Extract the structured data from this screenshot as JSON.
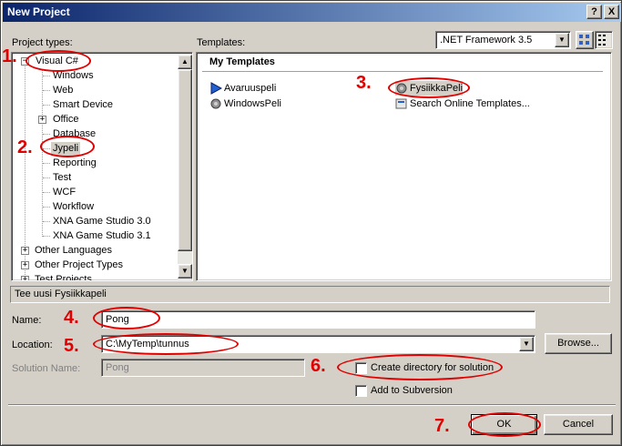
{
  "window": {
    "title": "New Project"
  },
  "titlebar_buttons": {
    "help": "?",
    "close": "X"
  },
  "project_types": {
    "label": "Project types:",
    "items": [
      {
        "label": "Visual C#",
        "expander": "−"
      },
      {
        "label": "Windows"
      },
      {
        "label": "Web"
      },
      {
        "label": "Smart Device"
      },
      {
        "label": "Office",
        "expander": "+"
      },
      {
        "label": "Database"
      },
      {
        "label": "Jypeli"
      },
      {
        "label": "Reporting"
      },
      {
        "label": "Test"
      },
      {
        "label": "WCF"
      },
      {
        "label": "Workflow"
      },
      {
        "label": "XNA Game Studio 3.0"
      },
      {
        "label": "XNA Game Studio 3.1"
      },
      {
        "label": "Other Languages",
        "expander": "+"
      },
      {
        "label": "Other Project Types",
        "expander": "+"
      },
      {
        "label": "Test Projects",
        "expander": "+"
      }
    ]
  },
  "templates": {
    "label": "Templates:",
    "framework": ".NET Framework 3.5",
    "section": "My Templates",
    "items": [
      {
        "label": "Avaruuspeli"
      },
      {
        "label": "WindowsPeli"
      },
      {
        "label": "FysiikkaPeli"
      },
      {
        "label": "Search Online Templates..."
      }
    ]
  },
  "description": "Tee uusi Fysiikkapeli",
  "form": {
    "name_label": "Name:",
    "name_value": "Pong",
    "location_label": "Location:",
    "location_value": "C:\\MyTemp\\tunnus",
    "browse": "Browse...",
    "solution_label": "Solution Name:",
    "solution_value": "Pong",
    "create_dir": "Create directory for solution",
    "subversion": "Add to Subversion"
  },
  "buttons": {
    "ok": "OK",
    "cancel": "Cancel"
  },
  "annotations": [
    "1.",
    "2.",
    "3.",
    "4.",
    "5.",
    "6.",
    "7."
  ],
  "colors": {
    "annotation": "#e00000",
    "title_start": "#0a246a",
    "title_end": "#a6caf0",
    "selection": "#d4d0c8"
  }
}
